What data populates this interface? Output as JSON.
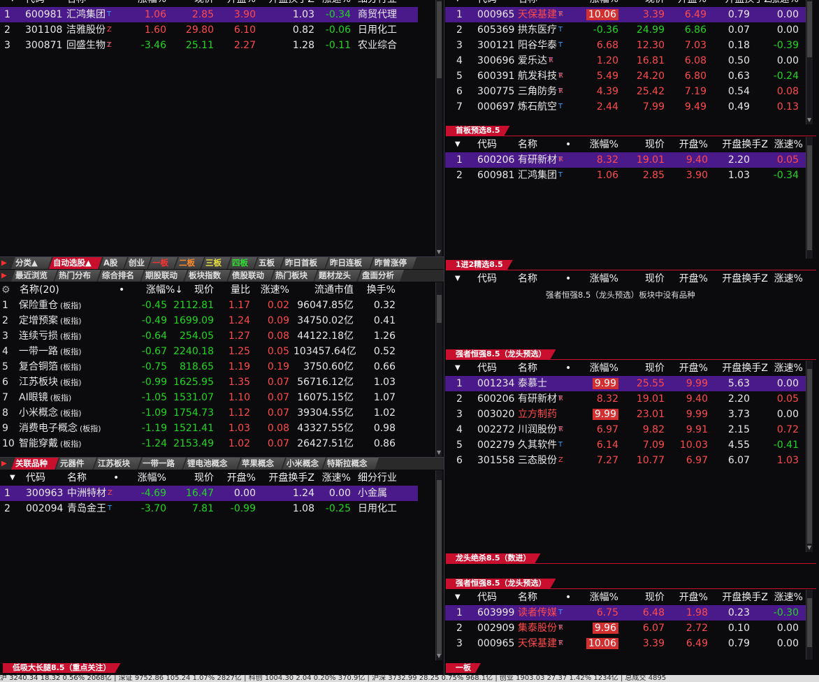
{
  "top_left": {
    "header": [
      "代码",
      "名称",
      "涨幅%",
      "现价",
      "开盘%",
      "开盘换手Z",
      "涨速%",
      "细分行业"
    ],
    "rows": [
      {
        "n": "1",
        "code": "600981",
        "name": "汇鸿集团",
        "tag": "T",
        "chg": "1.06",
        "price": "2.85",
        "open": "3.90",
        "oturn": "1.03",
        "speed": "-0.34",
        "ind": "商贸代理",
        "sel": true
      },
      {
        "n": "2",
        "code": "301108",
        "name": "洁雅股份",
        "tag": "Z",
        "chg": "1.60",
        "price": "29.80",
        "open": "6.10",
        "oturn": "0.82",
        "speed": "-0.06",
        "ind": "日用化工"
      },
      {
        "n": "3",
        "code": "300871",
        "name": "回盛生物",
        "tag": "TZ",
        "chg": "-3.46",
        "price": "25.11",
        "open": "2.27",
        "oturn": "1.28",
        "speed": "-0.11",
        "ind": "农业综合"
      }
    ]
  },
  "top_right": {
    "header": [
      "代码",
      "名称",
      "涨幅%",
      "现价",
      "开盘%",
      "开盘换手Z",
      "涨速%"
    ],
    "rows": [
      {
        "n": "1",
        "code": "000965",
        "name": "天保基建",
        "tag": "TR",
        "chg": "10.06",
        "price": "3.39",
        "open": "6.49",
        "oturn": "0.79",
        "speed": "0.00",
        "sel": true,
        "box": true,
        "namec": "up"
      },
      {
        "n": "2",
        "code": "605369",
        "name": "拱东医疗",
        "tag": "T",
        "chg": "-0.36",
        "price": "24.99",
        "open": "6.86",
        "oturn": "0.07",
        "speed": "0.00"
      },
      {
        "n": "3",
        "code": "300121",
        "name": "阳谷华泰",
        "tag": "T",
        "chg": "6.68",
        "price": "12.30",
        "open": "7.03",
        "oturn": "0.18",
        "speed": "-0.39"
      },
      {
        "n": "4",
        "code": "300696",
        "name": "爱乐达",
        "tag": "TR",
        "chg": "1.20",
        "price": "16.81",
        "open": "6.08",
        "oturn": "0.50",
        "speed": "0.00"
      },
      {
        "n": "5",
        "code": "600391",
        "name": "航发科技",
        "tag": "TR",
        "chg": "5.49",
        "price": "24.20",
        "open": "6.80",
        "oturn": "0.63",
        "speed": "-0.24"
      },
      {
        "n": "6",
        "code": "300775",
        "name": "三角防务",
        "tag": "TR",
        "chg": "4.39",
        "price": "25.42",
        "open": "7.19",
        "oturn": "0.54",
        "speed": "0.08"
      },
      {
        "n": "7",
        "code": "000697",
        "name": "炼石航空",
        "tag": "T",
        "chg": "2.44",
        "price": "7.99",
        "open": "9.49",
        "oturn": "0.49",
        "speed": "0.13"
      }
    ]
  },
  "banner_shouban": "首板预选8.5",
  "shouban": {
    "header": [
      "代码",
      "名称",
      "•",
      "涨幅%",
      "现价",
      "开盘%",
      "开盘换手Z",
      "涨速%"
    ],
    "rows": [
      {
        "n": "1",
        "code": "600206",
        "name": "有研新材",
        "tag": "TR",
        "chg": "8.32",
        "price": "19.01",
        "open": "9.40",
        "oturn": "2.20",
        "speed": "0.05",
        "sel": true
      },
      {
        "n": "2",
        "code": "600981",
        "name": "汇鸿集团",
        "tag": "T",
        "chg": "1.06",
        "price": "2.85",
        "open": "3.90",
        "oturn": "1.03",
        "speed": "-0.34"
      }
    ]
  },
  "banner_jin2": "1进2精选8.5",
  "jin2": {
    "header": [
      "代码",
      "名称",
      "•",
      "涨幅%",
      "现价",
      "开盘%",
      "开盘换手Z",
      "涨速%"
    ],
    "empty_msg": "强者恒强8.5（龙头预选）板块中没有品种"
  },
  "banner_qiang1": "强者恒强8.5（龙头预选）",
  "qiang1": {
    "header": [
      "代码",
      "名称",
      "•",
      "涨幅%",
      "现价",
      "开盘%",
      "开盘换手Z",
      "涨速%"
    ],
    "rows": [
      {
        "n": "1",
        "code": "001234",
        "name": "泰慕士",
        "tag": "",
        "chg": "9.99",
        "price": "25.55",
        "open": "9.99",
        "oturn": "5.63",
        "speed": "0.00",
        "sel": true,
        "box": true
      },
      {
        "n": "2",
        "code": "600206",
        "name": "有研新材",
        "tag": "TR",
        "chg": "8.32",
        "price": "19.01",
        "open": "9.40",
        "oturn": "2.20",
        "speed": "0.05"
      },
      {
        "n": "3",
        "code": "003020",
        "name": "立方制药",
        "tag": "",
        "chg": "9.99",
        "price": "23.01",
        "open": "9.99",
        "oturn": "3.73",
        "speed": "0.00",
        "box": true,
        "namec": "up"
      },
      {
        "n": "4",
        "code": "002272",
        "name": "川润股份",
        "tag": "TR",
        "chg": "6.97",
        "price": "9.82",
        "open": "9.91",
        "oturn": "2.15",
        "speed": "0.72"
      },
      {
        "n": "5",
        "code": "002279",
        "name": "久其软件",
        "tag": "T",
        "chg": "6.14",
        "price": "7.09",
        "open": "10.03",
        "oturn": "4.55",
        "speed": "-0.41"
      },
      {
        "n": "6",
        "code": "301558",
        "name": "三态股份",
        "tag": "Z",
        "chg": "7.27",
        "price": "10.77",
        "open": "6.97",
        "oturn": "6.07",
        "speed": "1.03"
      }
    ]
  },
  "banner_longtou": "龙头绝杀8.5（数进）",
  "banner_qiang2": "强者恒强8.5（龙头预选）",
  "qiang2": {
    "header": [
      "代码",
      "名称",
      "•",
      "涨幅%",
      "现价",
      "开盘%",
      "开盘换手Z",
      "涨速%"
    ],
    "rows": [
      {
        "n": "1",
        "code": "603999",
        "name": "读者传媒",
        "tag": "T",
        "chg": "6.75",
        "price": "6.48",
        "open": "1.98",
        "oturn": "0.23",
        "speed": "-0.30",
        "sel": true,
        "namec": "up"
      },
      {
        "n": "2",
        "code": "002909",
        "name": "集泰股份",
        "tag": "TR",
        "chg": "9.96",
        "price": "6.07",
        "open": "2.72",
        "oturn": "0.10",
        "speed": "0.00",
        "box": true,
        "namec": "up"
      },
      {
        "n": "3",
        "code": "000965",
        "name": "天保基建",
        "tag": "TR",
        "chg": "10.06",
        "price": "3.39",
        "open": "6.49",
        "oturn": "0.79",
        "speed": "0.00",
        "box": true,
        "namec": "up"
      }
    ]
  },
  "banner_yiban": "一板",
  "tabs1": [
    "分类▲",
    "自动选股▲",
    "A股",
    "创业",
    "一板",
    "二板",
    "三板",
    "四板",
    "五板",
    "昨日首板",
    "昨日连板",
    "昨曾涨停"
  ],
  "tabs2": [
    "最近浏览",
    "热门分布",
    "综合排名",
    "期股联动",
    "板块指数",
    "债股联动",
    "热门板块",
    "题材龙头",
    "盘面分析"
  ],
  "sector": {
    "header": [
      "名称(20)",
      "•",
      "涨幅%↓",
      "现价",
      "量比",
      "涨速%",
      "流通市值",
      "换手%"
    ],
    "rows": [
      {
        "n": "1",
        "name": "保险重仓",
        "suffix": "(板指)",
        "chg": "-0.45",
        "price": "2112.81",
        "vr": "1.17",
        "speed": "0.02",
        "mv": "96047.85亿",
        "turn": "0.32"
      },
      {
        "n": "2",
        "name": "定增预案",
        "suffix": "(板指)",
        "chg": "-0.49",
        "price": "1699.09",
        "vr": "1.24",
        "speed": "0.09",
        "mv": "34750.02亿",
        "turn": "0.41"
      },
      {
        "n": "3",
        "name": "连续亏损",
        "suffix": "(板指)",
        "chg": "-0.64",
        "price": "254.05",
        "vr": "1.27",
        "speed": "0.08",
        "mv": "44122.18亿",
        "turn": "1.26"
      },
      {
        "n": "4",
        "name": "一带一路",
        "suffix": "(板指)",
        "chg": "-0.67",
        "price": "2240.18",
        "vr": "1.25",
        "speed": "0.05",
        "mv": "103457.64亿",
        "turn": "0.52"
      },
      {
        "n": "5",
        "name": "复合铜箔",
        "suffix": "(板指)",
        "chg": "-0.75",
        "price": "818.65",
        "vr": "1.19",
        "speed": "0.19",
        "mv": "3750.60亿",
        "turn": "0.66"
      },
      {
        "n": "6",
        "name": "江苏板块",
        "suffix": "(板指)",
        "chg": "-0.99",
        "price": "1625.95",
        "vr": "1.35",
        "speed": "0.07",
        "mv": "56716.12亿",
        "turn": "1.03"
      },
      {
        "n": "7",
        "name": "AI眼镜",
        "suffix": "(板指)",
        "chg": "-1.05",
        "price": "1531.07",
        "vr": "1.10",
        "speed": "0.07",
        "mv": "16075.15亿",
        "turn": "1.07"
      },
      {
        "n": "8",
        "name": "小米概念",
        "suffix": "(板指)",
        "chg": "-1.09",
        "price": "1754.73",
        "vr": "1.12",
        "speed": "0.07",
        "mv": "39304.55亿",
        "turn": "1.02"
      },
      {
        "n": "9",
        "name": "消费电子概念",
        "suffix": "(板指)",
        "chg": "-1.19",
        "price": "1521.41",
        "vr": "1.03",
        "speed": "0.08",
        "mv": "43327.55亿",
        "turn": "0.98"
      },
      {
        "n": "10",
        "name": "智能穿戴",
        "suffix": "(板指)",
        "chg": "-1.24",
        "price": "2153.49",
        "vr": "1.02",
        "speed": "0.07",
        "mv": "26427.51亿",
        "turn": "0.86"
      }
    ]
  },
  "tabs3": [
    "关联品种",
    "元器件",
    "江苏板块",
    "一带一路",
    "锂电池概念",
    "苹果概念",
    "小米概念",
    "特斯拉概念"
  ],
  "related": {
    "header": [
      "代码",
      "名称",
      "•",
      "涨幅%",
      "现价",
      "开盘%",
      "开盘换手Z",
      "涨速%",
      "细分行业"
    ],
    "rows": [
      {
        "n": "1",
        "code": "300963",
        "name": "中洲特材",
        "tag": "Z",
        "chg": "-4.69",
        "price": "16.47",
        "open": "0.00",
        "oturn": "1.24",
        "speed": "0.00",
        "ind": "小金属",
        "sel": true
      },
      {
        "n": "2",
        "code": "002094",
        "name": "青岛金王",
        "tag": "T",
        "chg": "-3.70",
        "price": "7.81",
        "open": "-0.99",
        "oturn": "1.08",
        "speed": "-0.25",
        "ind": "日用化工"
      }
    ]
  },
  "banner_dixi": "低吸大长腿8.5（重点关注）",
  "status": "沪 3240.34  18.32  0.56%  2068亿 | 深证 9752.86  105.24  1.07%  2827亿 | 科创 1004.30  2.04  0.20%  370.9亿 | 沪深 3732.99  28.25  0.75%  968.1亿 | 创业 1903.03  27.37  1.42%  1234亿 | 总成交  4895"
}
